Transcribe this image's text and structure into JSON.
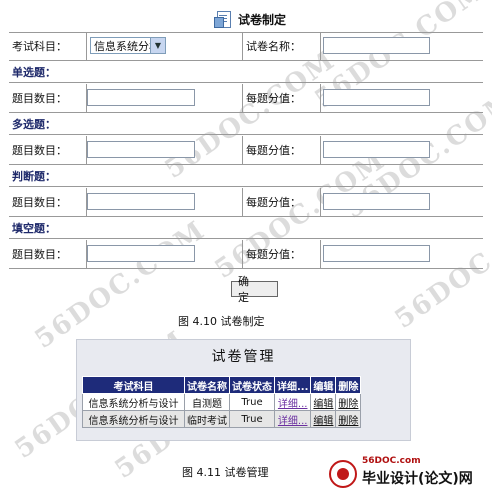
{
  "watermark": "56DOC.COM",
  "form": {
    "title": "试卷制定",
    "subject_label": "考试科目：",
    "subject_selected": "信息系统分析",
    "paper_name_label": "试卷名称：",
    "paper_name_value": "",
    "sections": [
      {
        "name": "单选题：",
        "count_label": "题目数目：",
        "score_label": "每题分值："
      },
      {
        "name": "多选题：",
        "count_label": "题目数目：",
        "score_label": "每题分值："
      },
      {
        "name": "判断题：",
        "count_label": "题目数目：",
        "score_label": "每题分值："
      },
      {
        "name": "填空题：",
        "count_label": "题目数目：",
        "score_label": "每题分值："
      }
    ],
    "confirm_label": "确 定"
  },
  "caption1": "图 4.10  试卷制定",
  "manage": {
    "title": "试卷管理",
    "headers": [
      "考试科目",
      "试卷名称",
      "试卷状态",
      "详细...",
      "编辑",
      "删除"
    ],
    "rows": [
      {
        "subject": "信息系统分析与设计",
        "name": "自测题",
        "status": "True",
        "detail": "详细...",
        "edit": "编辑",
        "delete": "删除"
      },
      {
        "subject": "信息系统分析与设计",
        "name": "临时考试",
        "status": "True",
        "detail": "详细...",
        "edit": "编辑",
        "delete": "删除"
      }
    ]
  },
  "caption2": "图 4.11  试卷管理",
  "brand": {
    "url": "56DOC.com",
    "name": "毕业设计(论文)网"
  },
  "colors": {
    "header_bg": "#1e2b7a",
    "section_text": "#1f2a6b",
    "link_visited": "#6a2fa0",
    "brand_red": "#c01818"
  }
}
